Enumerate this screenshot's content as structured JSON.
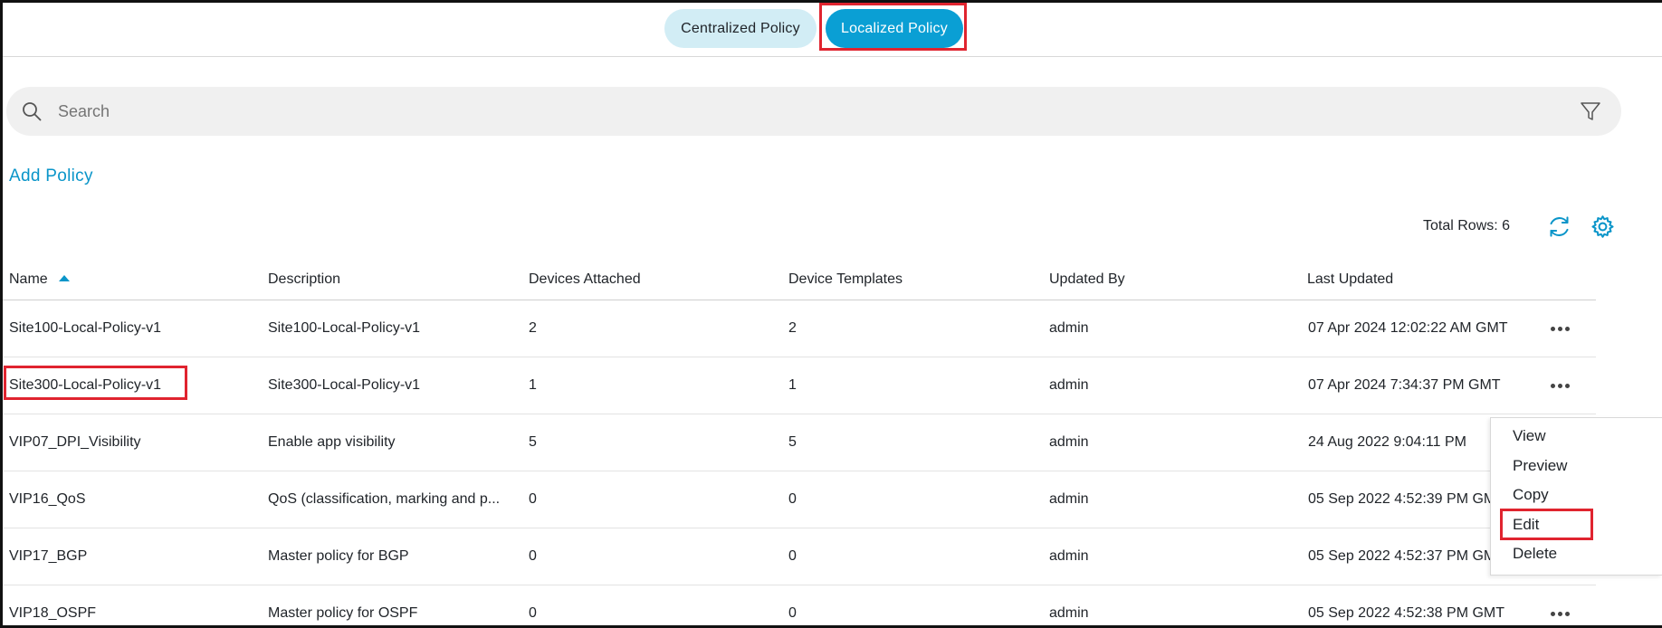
{
  "tabs": [
    {
      "label": "Centralized Policy",
      "active": false
    },
    {
      "label": "Localized Policy",
      "active": true
    }
  ],
  "search": {
    "placeholder": "Search"
  },
  "add_policy_label": "Add Policy",
  "total_rows_label": "Total Rows: 6",
  "table": {
    "columns": [
      "Name",
      "Description",
      "Devices Attached",
      "Device Templates",
      "Updated By",
      "Last Updated"
    ],
    "sort_column": "Name",
    "rows": [
      {
        "name": "Site100-Local-Policy-v1",
        "description": "Site100-Local-Policy-v1",
        "devices_attached": "2",
        "device_templates": "2",
        "updated_by": "admin",
        "last_updated": "07 Apr 2024 12:02:22 AM GMT"
      },
      {
        "name": "Site300-Local-Policy-v1",
        "description": "Site300-Local-Policy-v1",
        "devices_attached": "1",
        "device_templates": "1",
        "updated_by": "admin",
        "last_updated": "07 Apr 2024 7:34:37 PM GMT"
      },
      {
        "name": "VIP07_DPI_Visibility",
        "description": "Enable app visibility",
        "devices_attached": "5",
        "device_templates": "5",
        "updated_by": "admin",
        "last_updated": "24 Aug 2022 9:04:11 PM"
      },
      {
        "name": "VIP16_QoS",
        "description": "QoS (classification, marking and p...",
        "devices_attached": "0",
        "device_templates": "0",
        "updated_by": "admin",
        "last_updated": "05 Sep 2022 4:52:39 PM GMT"
      },
      {
        "name": "VIP17_BGP",
        "description": "Master policy for BGP",
        "devices_attached": "0",
        "device_templates": "0",
        "updated_by": "admin",
        "last_updated": "05 Sep 2022 4:52:37 PM GMT"
      },
      {
        "name": "VIP18_OSPF",
        "description": "Master policy for OSPF",
        "devices_attached": "0",
        "device_templates": "0",
        "updated_by": "admin",
        "last_updated": "05 Sep 2022 4:52:38 PM GMT"
      }
    ]
  },
  "context_menu": {
    "items": [
      "View",
      "Preview",
      "Copy",
      "Edit",
      "Delete"
    ]
  },
  "colors": {
    "accent": "#0a9fd4",
    "tab_inactive_bg": "#d2edf5",
    "highlight": "#e0242f"
  },
  "icons": [
    "search-icon",
    "filter-icon",
    "refresh-icon",
    "gear-icon",
    "more-options-icon",
    "sort-ascending-icon"
  ]
}
